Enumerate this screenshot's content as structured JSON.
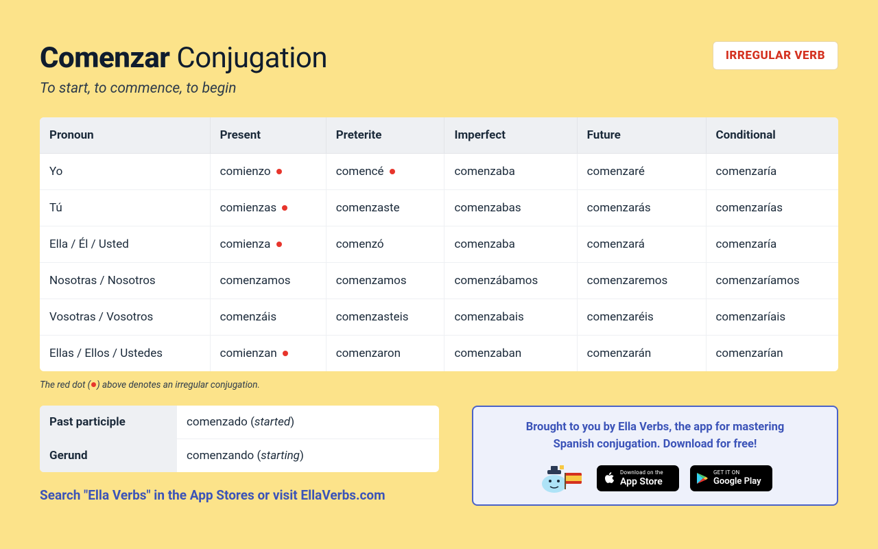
{
  "header": {
    "verb": "Comenzar",
    "suffix": " Conjugation",
    "subtitle": "To start, to commence, to begin",
    "badge": "IRREGULAR VERB"
  },
  "columns": [
    "Pronoun",
    "Present",
    "Preterite",
    "Imperfect",
    "Future",
    "Conditional"
  ],
  "rows": [
    {
      "pronoun": "Yo",
      "cells": [
        {
          "text": "comienzo",
          "irr": true
        },
        {
          "text": "comencé",
          "irr": true
        },
        {
          "text": "comenzaba",
          "irr": false
        },
        {
          "text": "comenzaré",
          "irr": false
        },
        {
          "text": "comenzaría",
          "irr": false
        }
      ]
    },
    {
      "pronoun": "Tú",
      "cells": [
        {
          "text": "comienzas",
          "irr": true
        },
        {
          "text": "comenzaste",
          "irr": false
        },
        {
          "text": "comenzabas",
          "irr": false
        },
        {
          "text": "comenzarás",
          "irr": false
        },
        {
          "text": "comenzarías",
          "irr": false
        }
      ]
    },
    {
      "pronoun": "Ella / Él / Usted",
      "cells": [
        {
          "text": "comienza",
          "irr": true
        },
        {
          "text": "comenzó",
          "irr": false
        },
        {
          "text": "comenzaba",
          "irr": false
        },
        {
          "text": "comenzará",
          "irr": false
        },
        {
          "text": "comenzaría",
          "irr": false
        }
      ]
    },
    {
      "pronoun": "Nosotras / Nosotros",
      "cells": [
        {
          "text": "comenzamos",
          "irr": false
        },
        {
          "text": "comenzamos",
          "irr": false
        },
        {
          "text": "comenzábamos",
          "irr": false
        },
        {
          "text": "comenzaremos",
          "irr": false
        },
        {
          "text": "comenzaríamos",
          "irr": false
        }
      ]
    },
    {
      "pronoun": "Vosotras / Vosotros",
      "cells": [
        {
          "text": "comenzáis",
          "irr": false
        },
        {
          "text": "comenzasteis",
          "irr": false
        },
        {
          "text": "comenzabais",
          "irr": false
        },
        {
          "text": "comenzaréis",
          "irr": false
        },
        {
          "text": "comenzaríais",
          "irr": false
        }
      ]
    },
    {
      "pronoun": "Ellas / Ellos / Ustedes",
      "cells": [
        {
          "text": "comienzan",
          "irr": true
        },
        {
          "text": "comenzaron",
          "irr": false
        },
        {
          "text": "comenzaban",
          "irr": false
        },
        {
          "text": "comenzarán",
          "irr": false
        },
        {
          "text": "comenzarían",
          "irr": false
        }
      ]
    }
  ],
  "footnote": {
    "before": "The red dot (",
    "after": ") above denotes an irregular conjugation."
  },
  "participles": [
    {
      "label": "Past participle",
      "value": "comenzado",
      "translation": "started"
    },
    {
      "label": "Gerund",
      "value": "comenzando",
      "translation": "starting"
    }
  ],
  "promo": {
    "line1": "Brought to you by Ella Verbs, the app for mastering",
    "line2": "Spanish conjugation. Download for free!",
    "appstore_small": "Download on the",
    "appstore_big": "App Store",
    "google_small": "GET IT ON",
    "google_big": "Google Play"
  },
  "search_line": "Search \"Ella Verbs\" in the App Stores or visit EllaVerbs.com"
}
